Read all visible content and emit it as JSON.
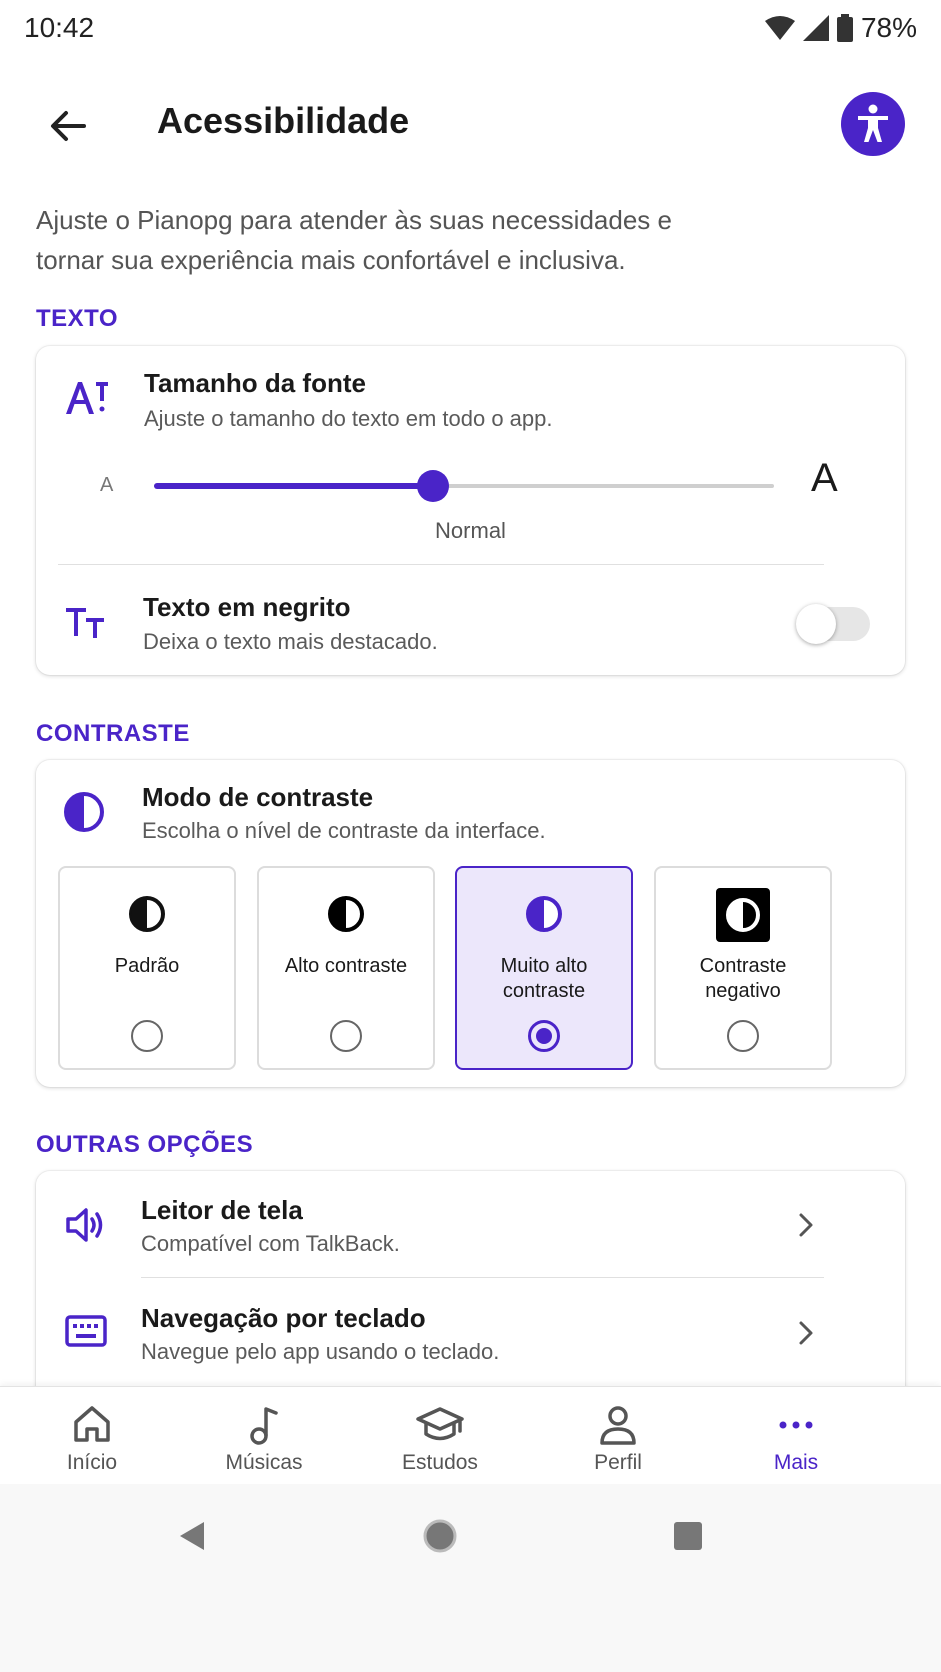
{
  "status_bar": {
    "time": "10:42",
    "battery": "78%"
  },
  "header": {
    "title": "Acessibilidade"
  },
  "intro": "Ajuste o Pianopg para atender às suas necessidades e tornar sua experiência mais confortável e inclusiva.",
  "sections": {
    "texto": {
      "label": "TEXTO",
      "font_size": {
        "title": "Tamanho da fonte",
        "subtitle": "Ajuste o tamanho do texto em todo o app.",
        "small_a": "A",
        "large_a": "A",
        "value_label": "Normal",
        "level": 0.45
      },
      "bold_text": {
        "title": "Texto em negrito",
        "subtitle": "Deixa o texto mais destacado.",
        "enabled": false
      }
    },
    "contraste": {
      "label": "CONTRASTE",
      "mode": {
        "title": "Modo de contraste",
        "subtitle": "Escolha o nível de contraste da interface."
      },
      "options": [
        {
          "label": "Padrão",
          "selected": false,
          "icon": "contrast-standard-icon"
        },
        {
          "label": "Alto contraste",
          "selected": false,
          "icon": "contrast-high-icon"
        },
        {
          "label": "Muito alto contraste",
          "selected": true,
          "icon": "contrast-very-high-icon"
        },
        {
          "label": "Contraste negativo",
          "selected": false,
          "icon": "contrast-negative-icon"
        }
      ]
    },
    "outras": {
      "label": "OUTRAS OPÇÕES",
      "items": [
        {
          "title": "Leitor de tela",
          "subtitle": "Compatível com TalkBack.",
          "icon": "speaker-icon"
        },
        {
          "title": "Navegação por teclado",
          "subtitle": "Navegue pelo app usando o teclado.",
          "icon": "keyboard-icon"
        }
      ]
    }
  },
  "bottom_nav": {
    "items": [
      {
        "label": "Início",
        "icon": "home-icon",
        "active": false
      },
      {
        "label": "Músicas",
        "icon": "music-note-icon",
        "active": false
      },
      {
        "label": "Estudos",
        "icon": "graduation-cap-icon",
        "active": false
      },
      {
        "label": "Perfil",
        "icon": "person-icon",
        "active": false
      },
      {
        "label": "Mais",
        "icon": "more-dots-icon",
        "active": true
      }
    ]
  },
  "colors": {
    "accent": "#4a24c8",
    "accent_light": "#ece7fb",
    "text": "#1a1a1a",
    "muted": "#5a5a5a"
  }
}
